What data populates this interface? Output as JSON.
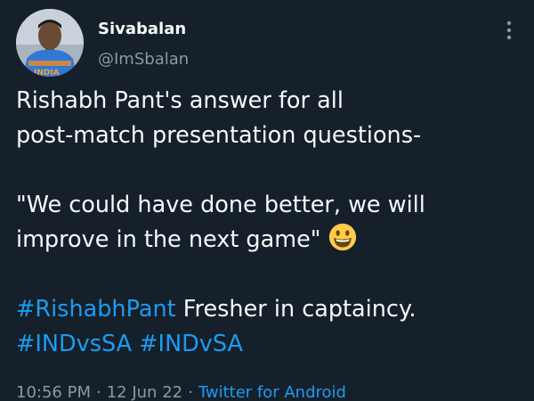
{
  "author": {
    "display_name": "Sivabalan",
    "handle": "@ImSbalan",
    "avatar_jersey_text": "INDIA"
  },
  "tweet": {
    "line1": "Rishabh Pant's answer for all",
    "line2": "post-match presentation questions-",
    "quote_line1": "\"We could have done better, we will",
    "quote_line2": "improve in the next game\"",
    "hashtag1": "#RishabhPant",
    "line5_rest": " Fresher in captaincy.",
    "hashtag2": "#INDvsSA",
    "hashtag3": "#INDvSA"
  },
  "meta": {
    "time": "10:56 PM",
    "separator": "·",
    "date": "12 Jun 22",
    "source": "Twitter for Android"
  },
  "colors": {
    "background": "#15202b",
    "text": "#f7f9f9",
    "secondary": "#8b98a5",
    "link": "#1d9bf0"
  },
  "icons": {
    "more": "more-vertical-icon",
    "emoji": "grinning-face-emoji"
  }
}
